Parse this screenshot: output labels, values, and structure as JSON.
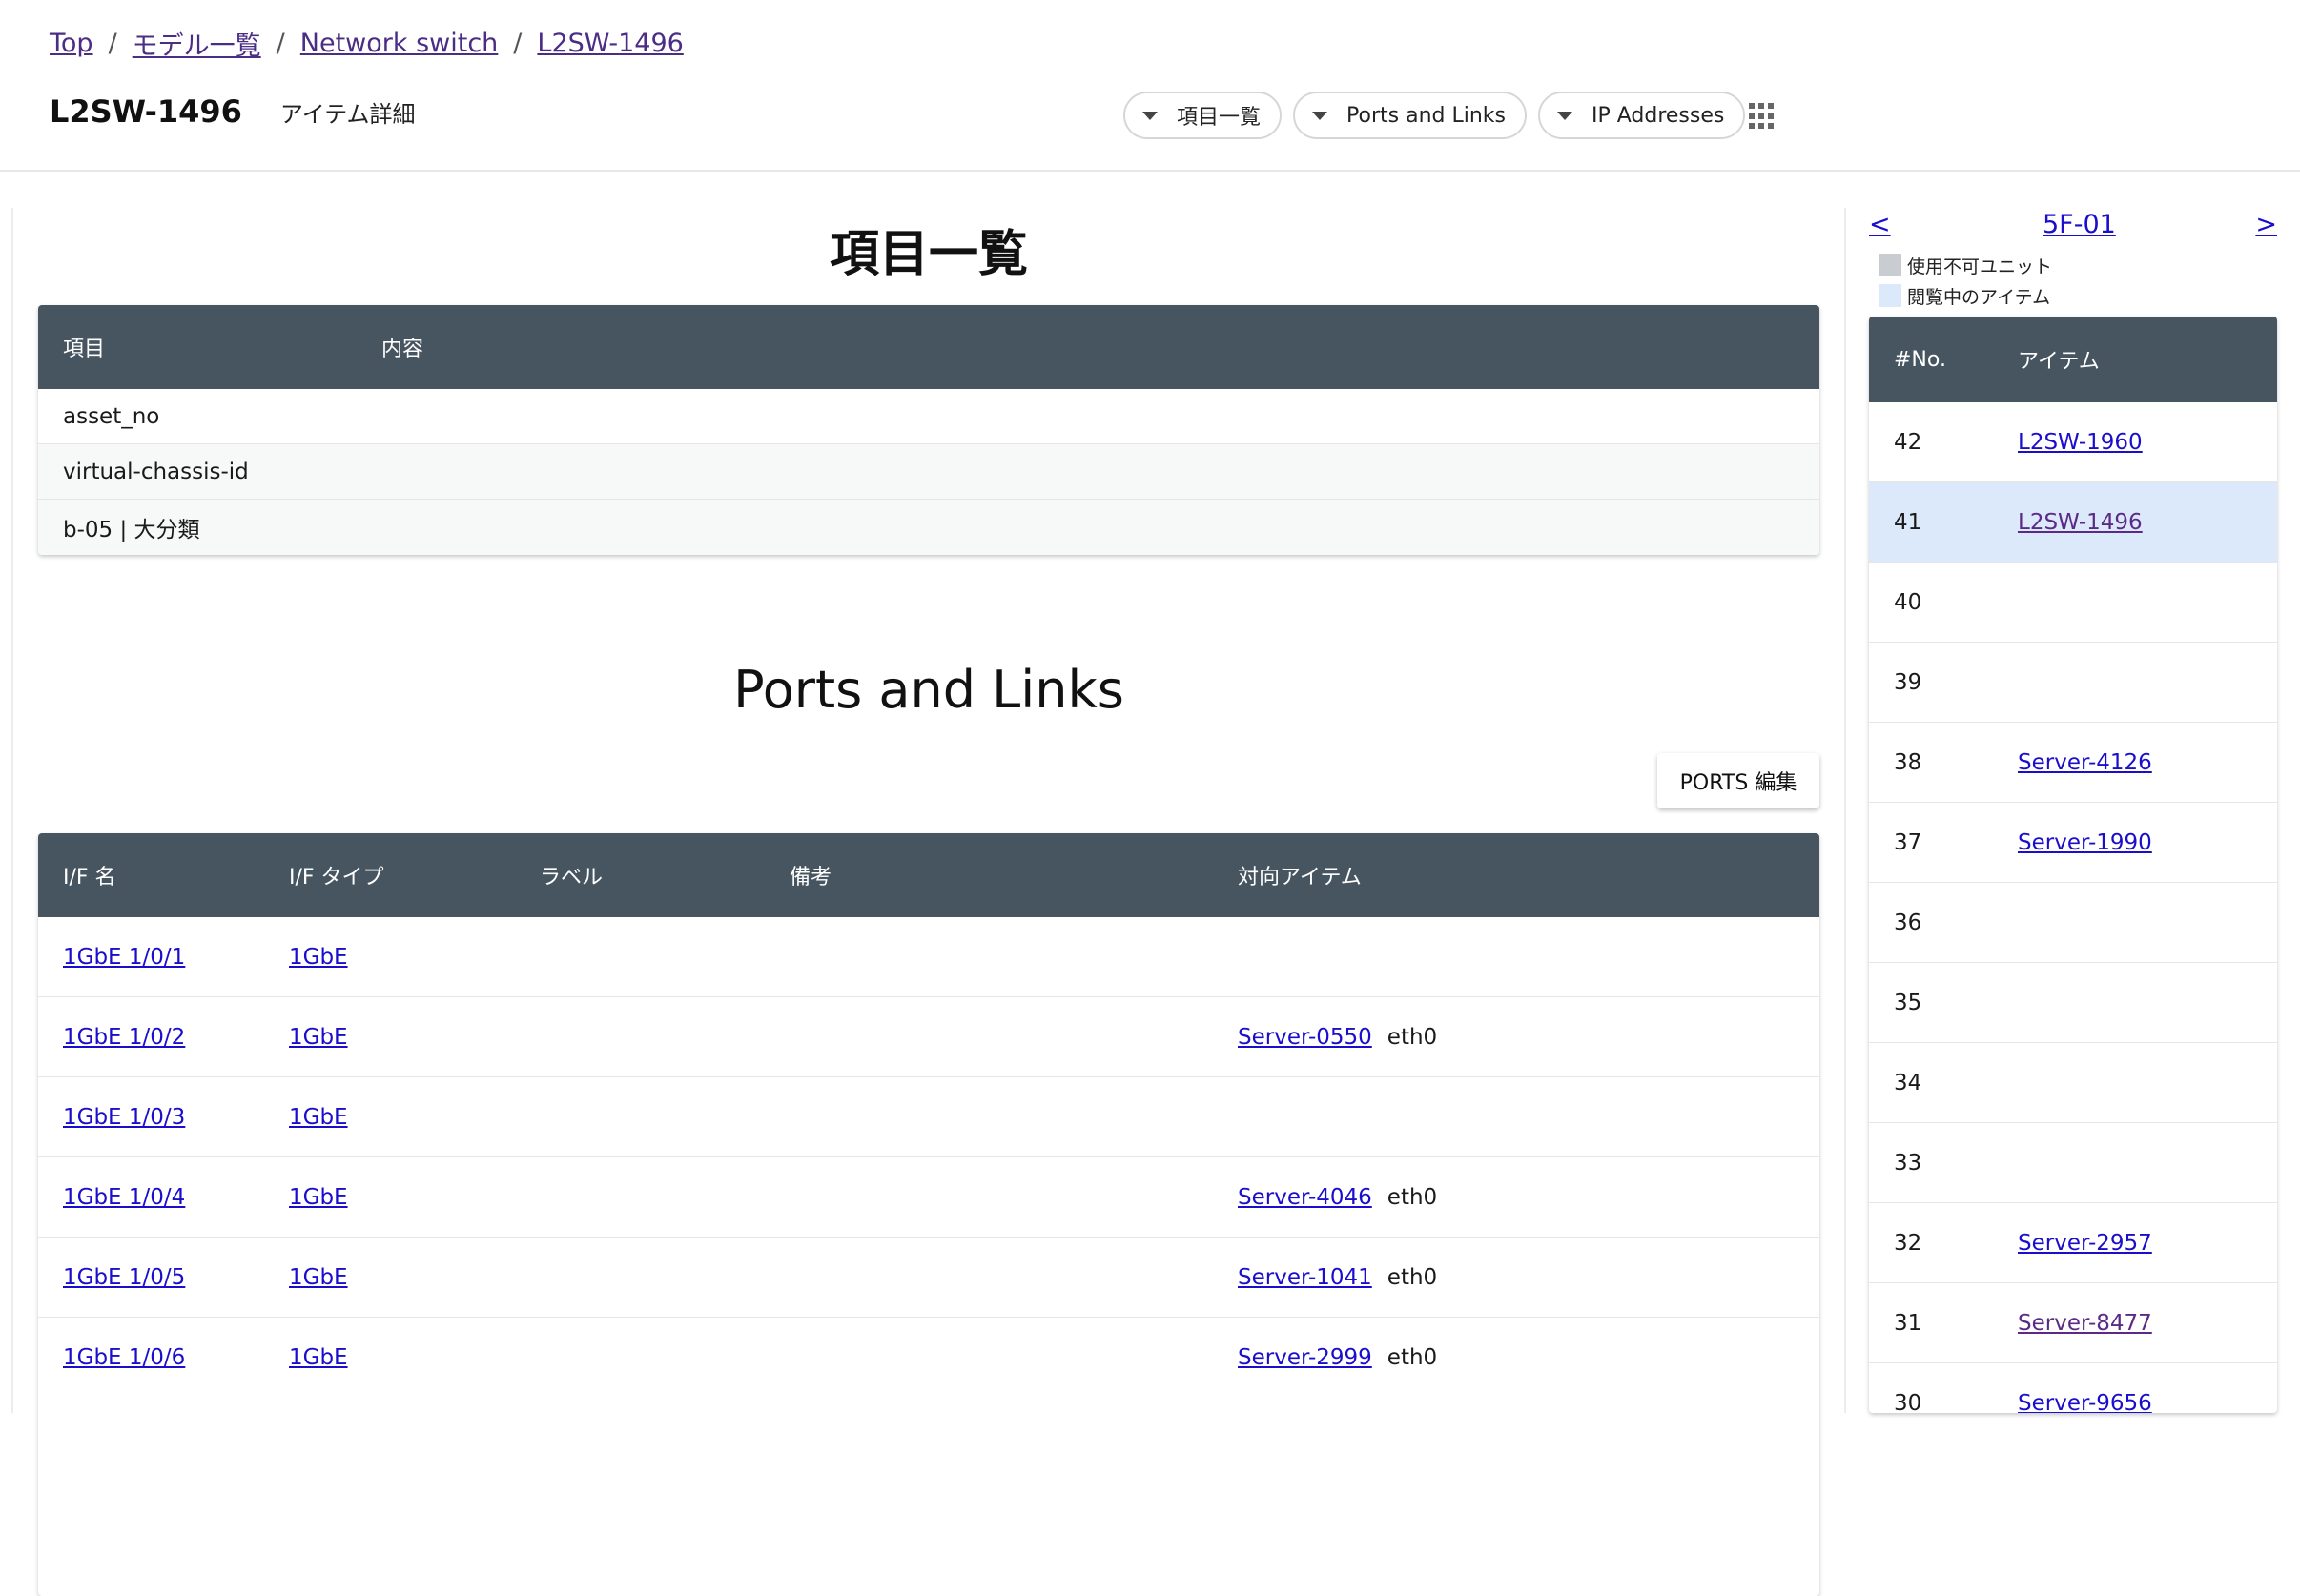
{
  "breadcrumb": [
    {
      "label": "Top"
    },
    {
      "label": "モデル一覧"
    },
    {
      "label": "Network switch"
    },
    {
      "label": "L2SW-1496"
    }
  ],
  "header": {
    "title": "L2SW-1496",
    "subtitle": "アイテム詳細",
    "jump_buttons": [
      "項目一覧",
      "Ports and Links",
      "IP Addresses"
    ],
    "apps_icon": "grid-icon"
  },
  "items_section": {
    "title": "項目一覧",
    "columns": [
      "項目",
      "内容"
    ],
    "rows": [
      {
        "key": "asset_no",
        "value": ""
      },
      {
        "key": "virtual-chassis-id",
        "value": ""
      },
      {
        "key": "b-05 | 大分類",
        "value": ""
      }
    ]
  },
  "ports_section": {
    "title": "Ports and Links",
    "edit_button": "PORTS 編集",
    "columns": [
      "I/F 名",
      "I/F タイプ",
      "ラベル",
      "備考",
      "対向アイテム"
    ],
    "rows": [
      {
        "if_name": "1GbE 1/0/1",
        "if_type": "1GbE",
        "label": "",
        "note": "",
        "peer": "",
        "peer_if": ""
      },
      {
        "if_name": "1GbE 1/0/2",
        "if_type": "1GbE",
        "label": "",
        "note": "",
        "peer": "Server-0550",
        "peer_if": "eth0"
      },
      {
        "if_name": "1GbE 1/0/3",
        "if_type": "1GbE",
        "label": "",
        "note": "",
        "peer": "",
        "peer_if": ""
      },
      {
        "if_name": "1GbE 1/0/4",
        "if_type": "1GbE",
        "label": "",
        "note": "",
        "peer": "Server-4046",
        "peer_if": "eth0"
      },
      {
        "if_name": "1GbE 1/0/5",
        "if_type": "1GbE",
        "label": "",
        "note": "",
        "peer": "Server-1041",
        "peer_if": "eth0"
      },
      {
        "if_name": "1GbE 1/0/6",
        "if_type": "1GbE",
        "label": "",
        "note": "",
        "peer": "Server-2999",
        "peer_if": "eth0"
      }
    ]
  },
  "rack": {
    "prev": "<",
    "name": "5F-01",
    "next": ">",
    "legend": [
      "使用不可ユニット",
      "閲覧中のアイテム"
    ],
    "columns": [
      "#No.",
      "アイテム"
    ],
    "rows": [
      {
        "no": "42",
        "item": "L2SW-1960"
      },
      {
        "no": "41",
        "item": "L2SW-1496",
        "current": true
      },
      {
        "no": "40",
        "item": ""
      },
      {
        "no": "39",
        "item": ""
      },
      {
        "no": "38",
        "item": "Server-4126"
      },
      {
        "no": "37",
        "item": "Server-1990"
      },
      {
        "no": "36",
        "item": ""
      },
      {
        "no": "35",
        "item": ""
      },
      {
        "no": "34",
        "item": ""
      },
      {
        "no": "33",
        "item": ""
      },
      {
        "no": "32",
        "item": "Server-2957"
      },
      {
        "no": "31",
        "item": "Server-8477"
      },
      {
        "no": "30",
        "item": "Server-9656"
      }
    ]
  }
}
